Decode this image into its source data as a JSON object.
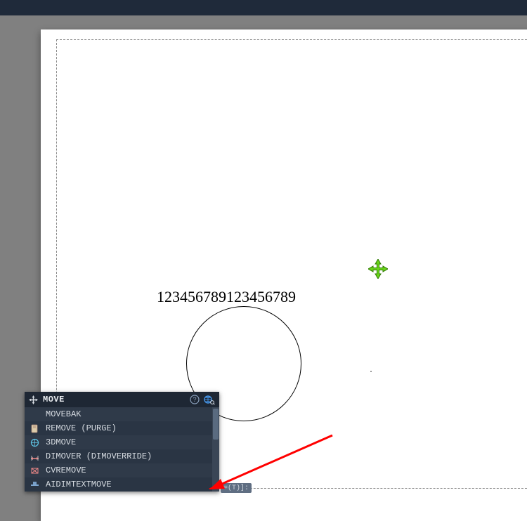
{
  "canvas": {
    "sample_text": "123456789123456789"
  },
  "autocomplete": {
    "title": "MOVE",
    "items": [
      {
        "icon": "move",
        "label": "MOVEBAK"
      },
      {
        "icon": "purge",
        "label": "REMOVE (PURGE)"
      },
      {
        "icon": "3d",
        "label": "3DMOVE"
      },
      {
        "icon": "dim",
        "label": "DIMOVER (DIMOVERRIDE)"
      },
      {
        "icon": "cvr",
        "label": "CVREMOVE"
      },
      {
        "icon": "ai",
        "label": "AIDIMTEXTMOVE"
      }
    ]
  },
  "command_hint": "=(T)]:",
  "colors": {
    "accent_green": "#69d41a",
    "panel_bg": "#2a3544",
    "header_bg": "#1e2734",
    "arrow_red": "#ff0000"
  }
}
